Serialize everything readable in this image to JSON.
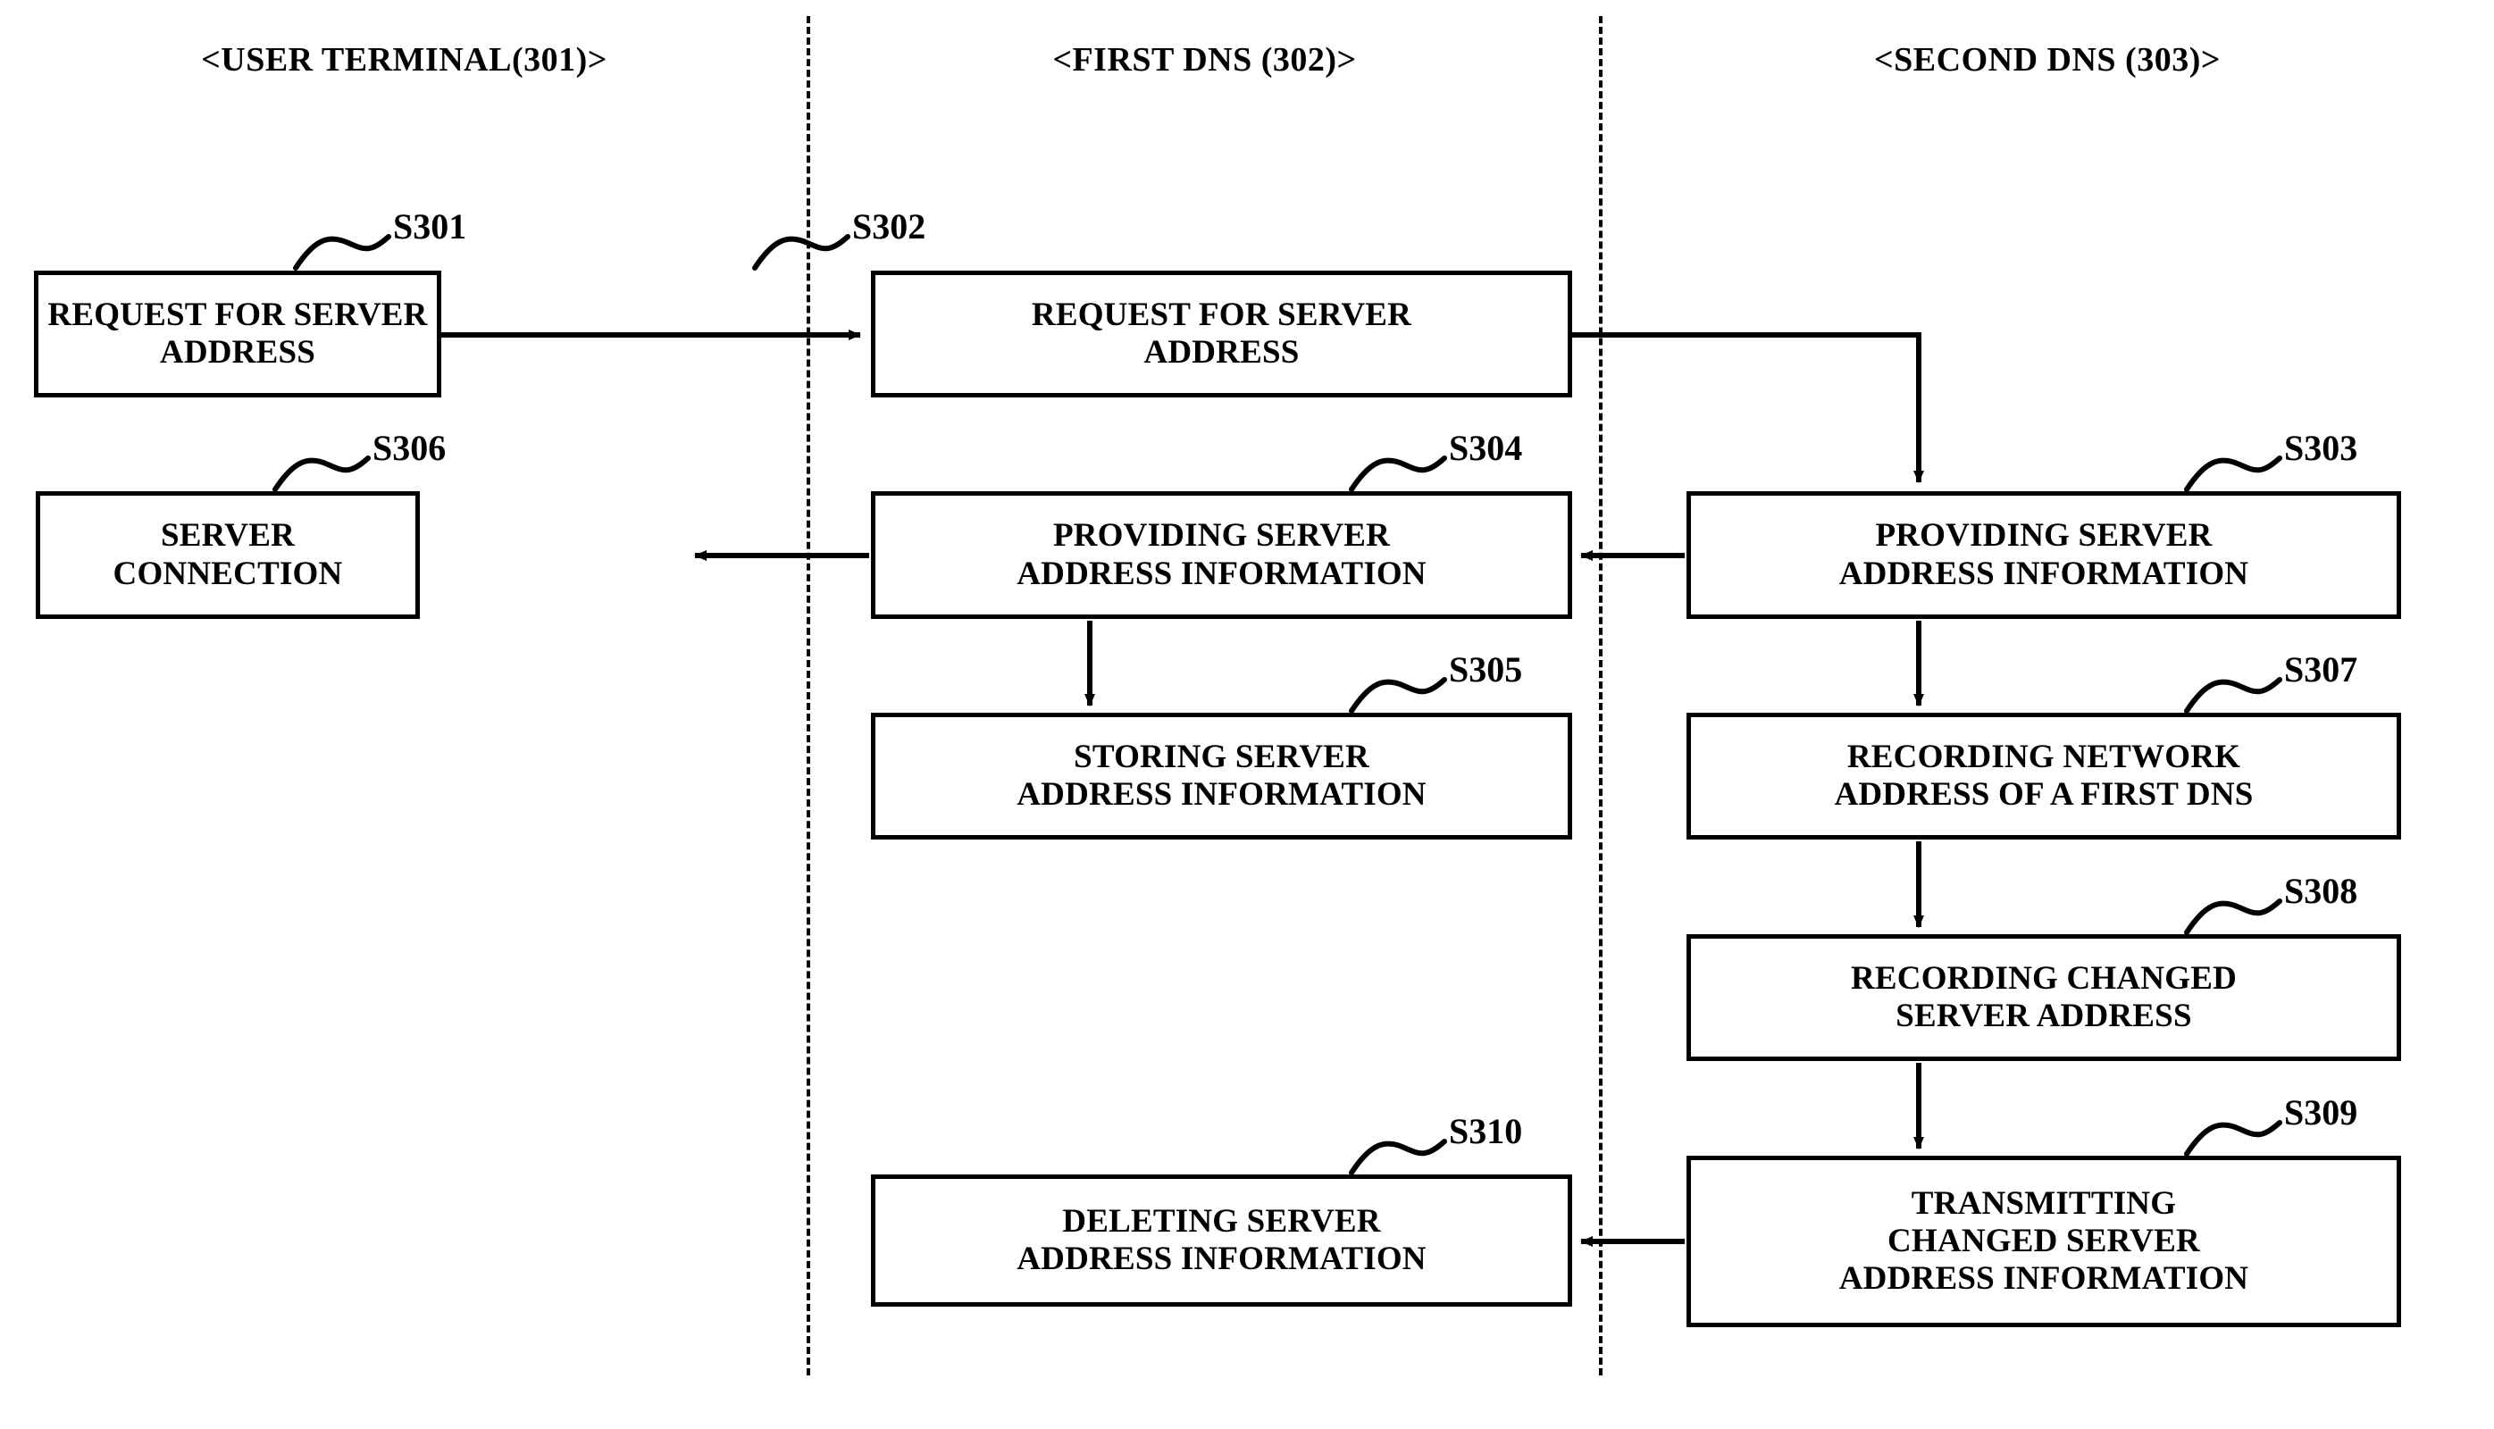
{
  "figure": {
    "lanes": [
      {
        "id": "user-terminal",
        "label": "<USER TERMINAL(301)>"
      },
      {
        "id": "first-dns",
        "label": "<FIRST DNS (302)>"
      },
      {
        "id": "second-dns",
        "label": "<SECOND DNS (303)>"
      }
    ],
    "steps": [
      {
        "id": "S301",
        "ref": "S301",
        "lane": "user-terminal",
        "text": "REQUEST FOR SERVER\nADDRESS"
      },
      {
        "id": "S302",
        "ref": "S302",
        "lane": "first-dns",
        "text": "REQUEST FOR SERVER\nADDRESS"
      },
      {
        "id": "S303",
        "ref": "S303",
        "lane": "second-dns",
        "text": "PROVIDING SERVER\nADDRESS INFORMATION"
      },
      {
        "id": "S304",
        "ref": "S304",
        "lane": "first-dns",
        "text": "PROVIDING SERVER\nADDRESS INFORMATION"
      },
      {
        "id": "S305",
        "ref": "S305",
        "lane": "first-dns",
        "text": "STORING SERVER\nADDRESS INFORMATION"
      },
      {
        "id": "S306",
        "ref": "S306",
        "lane": "user-terminal",
        "text": "SERVER CONNECTION"
      },
      {
        "id": "S307",
        "ref": "S307",
        "lane": "second-dns",
        "text": "RECORDING NETWORK\nADDRESS OF A FIRST DNS"
      },
      {
        "id": "S308",
        "ref": "S308",
        "lane": "second-dns",
        "text": "RECORDING CHANGED\nSERVER ADDRESS"
      },
      {
        "id": "S309",
        "ref": "S309",
        "lane": "second-dns",
        "text": "TRANSMITTING\nCHANGED SERVER\nADDRESS INFORMATION"
      },
      {
        "id": "S310",
        "ref": "S310",
        "lane": "first-dns",
        "text": "DELETING SERVER\nADDRESS INFORMATION"
      }
    ],
    "flows": [
      {
        "from": "S301",
        "to": "S302",
        "direction": "right"
      },
      {
        "from": "S302",
        "to": "S303",
        "direction": "right-down"
      },
      {
        "from": "S303",
        "to": "S304",
        "direction": "left"
      },
      {
        "from": "S304",
        "to": "S306",
        "direction": "left"
      },
      {
        "from": "S304",
        "to": "S305",
        "direction": "down"
      },
      {
        "from": "S303",
        "to": "S307",
        "direction": "down"
      },
      {
        "from": "S307",
        "to": "S308",
        "direction": "down"
      },
      {
        "from": "S308",
        "to": "S309",
        "direction": "down"
      },
      {
        "from": "S309",
        "to": "S310",
        "direction": "left"
      }
    ],
    "colors": {
      "ink": "#000000",
      "paper": "#ffffff"
    }
  }
}
